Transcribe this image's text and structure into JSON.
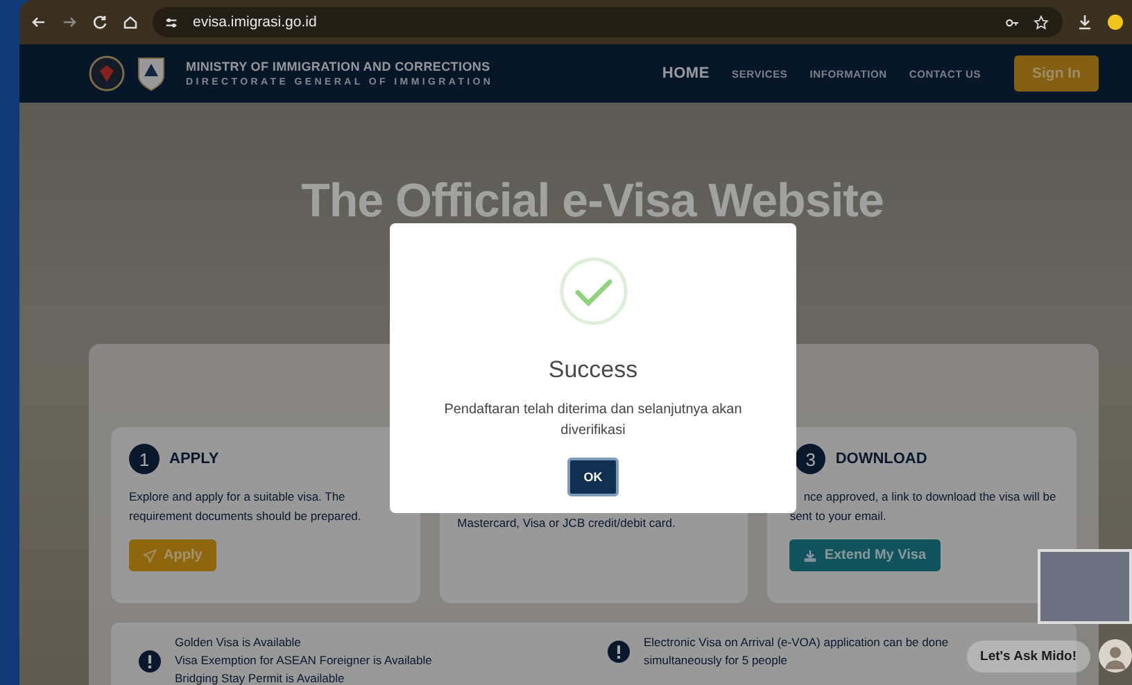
{
  "browser": {
    "url": "evisa.imigrasi.go.id"
  },
  "header": {
    "line1": "MINISTRY OF IMMIGRATION AND CORRECTIONS",
    "line2": "DIRECTORATE GENERAL OF IMMIGRATION",
    "nav": [
      {
        "label": "HOME",
        "selected": true
      },
      {
        "label": "SERVICES",
        "selected": false
      },
      {
        "label": "INFORMATION",
        "selected": false
      },
      {
        "label": "CONTACT US",
        "selected": false
      }
    ],
    "sign_in": "Sign In"
  },
  "hero_title": "The Official e-Visa Website",
  "steps": [
    {
      "number": "1",
      "title": "APPLY",
      "text": "Explore and apply for a suitable visa. The requirement documents should be prepared.",
      "button": {
        "label": "Apply",
        "kind": "apply"
      }
    },
    {
      "text": "Mastercard, Visa or JCB credit/debit card."
    },
    {
      "number": "3",
      "title": "DOWNLOAD",
      "text": "nce approved, a link to download the visa will be sent to your email.",
      "button": {
        "label": "Extend My Visa",
        "kind": "download"
      }
    }
  ],
  "notices": {
    "left": [
      "Golden Visa is Available",
      "Visa Exemption for ASEAN Foreigner is Available",
      "Bridging Stay Permit is Available"
    ],
    "right": [
      "Electronic Visa on Arrival (e-VOA) application can be done simultaneously for 5 people"
    ]
  },
  "chat_label": "Let's Ask Mido!",
  "modal": {
    "title": "Success",
    "message": "Pendaftaran telah diterima dan selanjutnya akan diverifikasi",
    "button": "OK"
  }
}
